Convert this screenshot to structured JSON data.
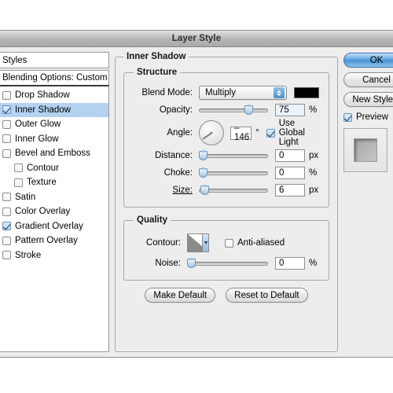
{
  "window": {
    "title": "Layer Style"
  },
  "sidebar": {
    "styles_label": "Styles",
    "blending_options_label": "Blending Options: Custom",
    "effects": [
      {
        "label": "Drop Shadow",
        "checked": false,
        "selected": false,
        "indent": false
      },
      {
        "label": "Inner Shadow",
        "checked": true,
        "selected": true,
        "indent": false
      },
      {
        "label": "Outer Glow",
        "checked": false,
        "selected": false,
        "indent": false
      },
      {
        "label": "Inner Glow",
        "checked": false,
        "selected": false,
        "indent": false
      },
      {
        "label": "Bevel and Emboss",
        "checked": false,
        "selected": false,
        "indent": false
      },
      {
        "label": "Contour",
        "checked": false,
        "selected": false,
        "indent": true
      },
      {
        "label": "Texture",
        "checked": false,
        "selected": false,
        "indent": true
      },
      {
        "label": "Satin",
        "checked": false,
        "selected": false,
        "indent": false
      },
      {
        "label": "Color Overlay",
        "checked": false,
        "selected": false,
        "indent": false
      },
      {
        "label": "Gradient Overlay",
        "checked": true,
        "selected": false,
        "indent": false
      },
      {
        "label": "Pattern Overlay",
        "checked": false,
        "selected": false,
        "indent": false
      },
      {
        "label": "Stroke",
        "checked": false,
        "selected": false,
        "indent": false
      }
    ]
  },
  "panel": {
    "title": "Inner Shadow",
    "structure": {
      "legend": "Structure",
      "blend_mode_label": "Blend Mode:",
      "blend_mode_value": "Multiply",
      "shadow_color": "#000000",
      "opacity_label": "Opacity:",
      "opacity_value": "75",
      "opacity_unit": "%",
      "opacity_percent": 75,
      "angle_label": "Angle:",
      "angle_value": "–146",
      "angle_unit": "°",
      "angle_degrees": -146,
      "use_global_light_label": "Use Global Light",
      "use_global_light_checked": true,
      "distance_label": "Distance:",
      "distance_value": "0",
      "distance_unit": "px",
      "distance_percent": 0,
      "choke_label": "Choke:",
      "choke_value": "0",
      "choke_unit": "%",
      "choke_percent": 0,
      "size_label": "Size:",
      "size_value": "6",
      "size_unit": "px",
      "size_percent": 2
    },
    "quality": {
      "legend": "Quality",
      "contour_label": "Contour:",
      "anti_aliased_label": "Anti-aliased",
      "anti_aliased_checked": false,
      "noise_label": "Noise:",
      "noise_value": "0",
      "noise_unit": "%",
      "noise_percent": 0
    },
    "make_default_label": "Make Default",
    "reset_to_default_label": "Reset to Default"
  },
  "actions": {
    "ok_label": "OK",
    "cancel_label": "Cancel",
    "new_style_label": "New Style...",
    "preview_label": "Preview",
    "preview_checked": true
  }
}
